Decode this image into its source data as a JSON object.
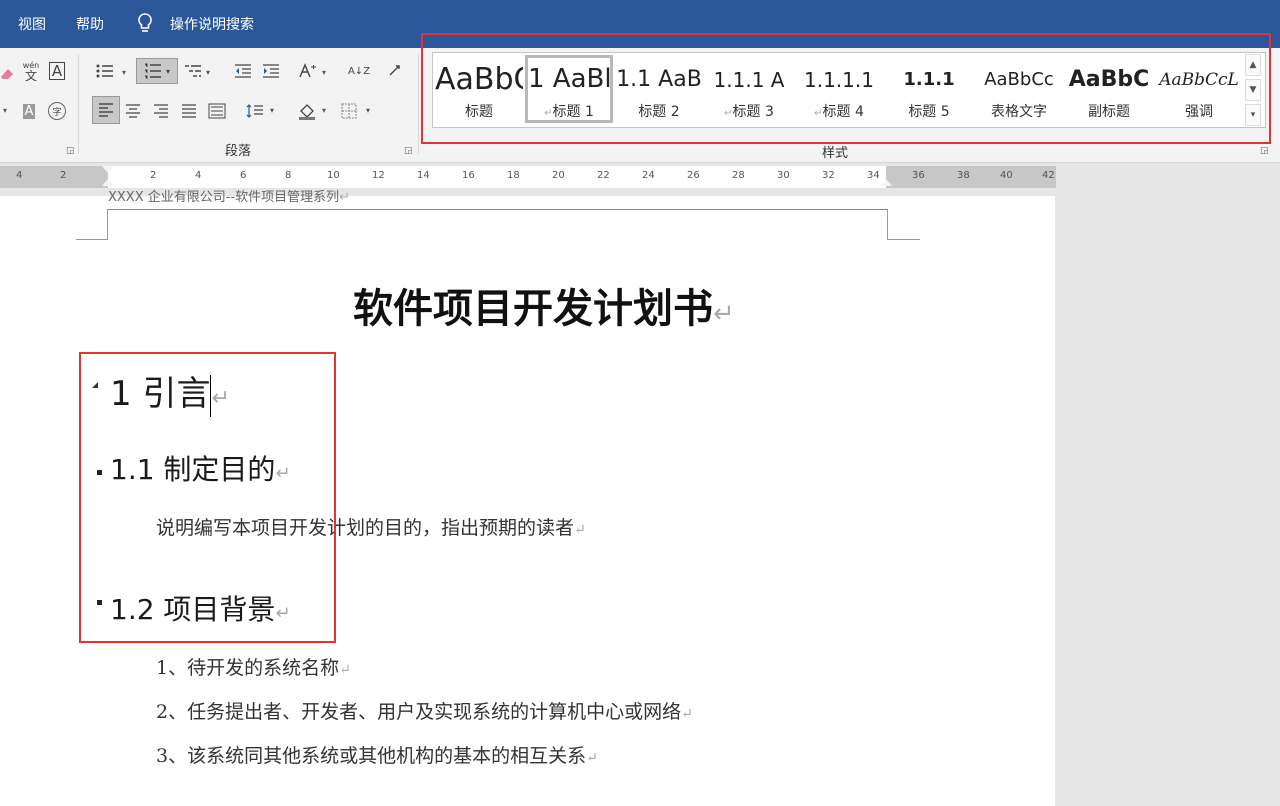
{
  "menu": {
    "view": "视图",
    "help": "帮助",
    "search": "操作说明搜索"
  },
  "ribbon": {
    "paragraph_label": "段落",
    "styles_label": "样式",
    "pinyin_glyph": "wén",
    "pinyin_char": "文",
    "char_border_glyph": "A",
    "shade_glyph": "A",
    "enclose_glyph": "字",
    "sort_glyph": "A↓Z"
  },
  "styles": [
    {
      "preview": "AaBbC",
      "name": "标题"
    },
    {
      "preview": "1 AaBl",
      "name": "标题 1",
      "mark": "↵"
    },
    {
      "preview": "1.1 AaB",
      "name": "标题 2"
    },
    {
      "preview": "1.1.1 A",
      "name": "标题 3",
      "mark": "↵"
    },
    {
      "preview": "1.1.1.1",
      "name": "标题 4",
      "mark": "↵"
    },
    {
      "preview": "1.1.1",
      "name": "标题 5"
    },
    {
      "preview": "AaBbCc",
      "name": "表格文字"
    },
    {
      "preview": "AaBbC",
      "name": "副标题"
    },
    {
      "preview": "AaBbCcL",
      "name": "强调"
    }
  ],
  "ruler": {
    "left_ticks": [
      "4",
      "2"
    ],
    "ticks": [
      "2",
      "4",
      "6",
      "8",
      "10",
      "12",
      "14",
      "16",
      "18",
      "20",
      "22",
      "24",
      "26",
      "28",
      "30",
      "32",
      "34",
      "36",
      "38",
      "40",
      "42"
    ]
  },
  "document": {
    "header_text": "XXXX 企业有限公司--软件项目管理系列",
    "title": "软件项目开发计划书",
    "h1": "1 引言",
    "h2a": "1.1 制定目的",
    "p1": "说明编写本项目开发计划的目的，指出预期的读者",
    "h2b": "1.2 项目背景",
    "list": [
      "1、待开发的系统名称",
      "2、任务提出者、开发者、用户及实现系统的计算机中心或网络",
      "3、该系统同其他系统或其他机构的基本的相互关系"
    ],
    "para_mark": "↵"
  },
  "colors": {
    "title_bar": "#2b579a",
    "highlight": "#e53333"
  }
}
